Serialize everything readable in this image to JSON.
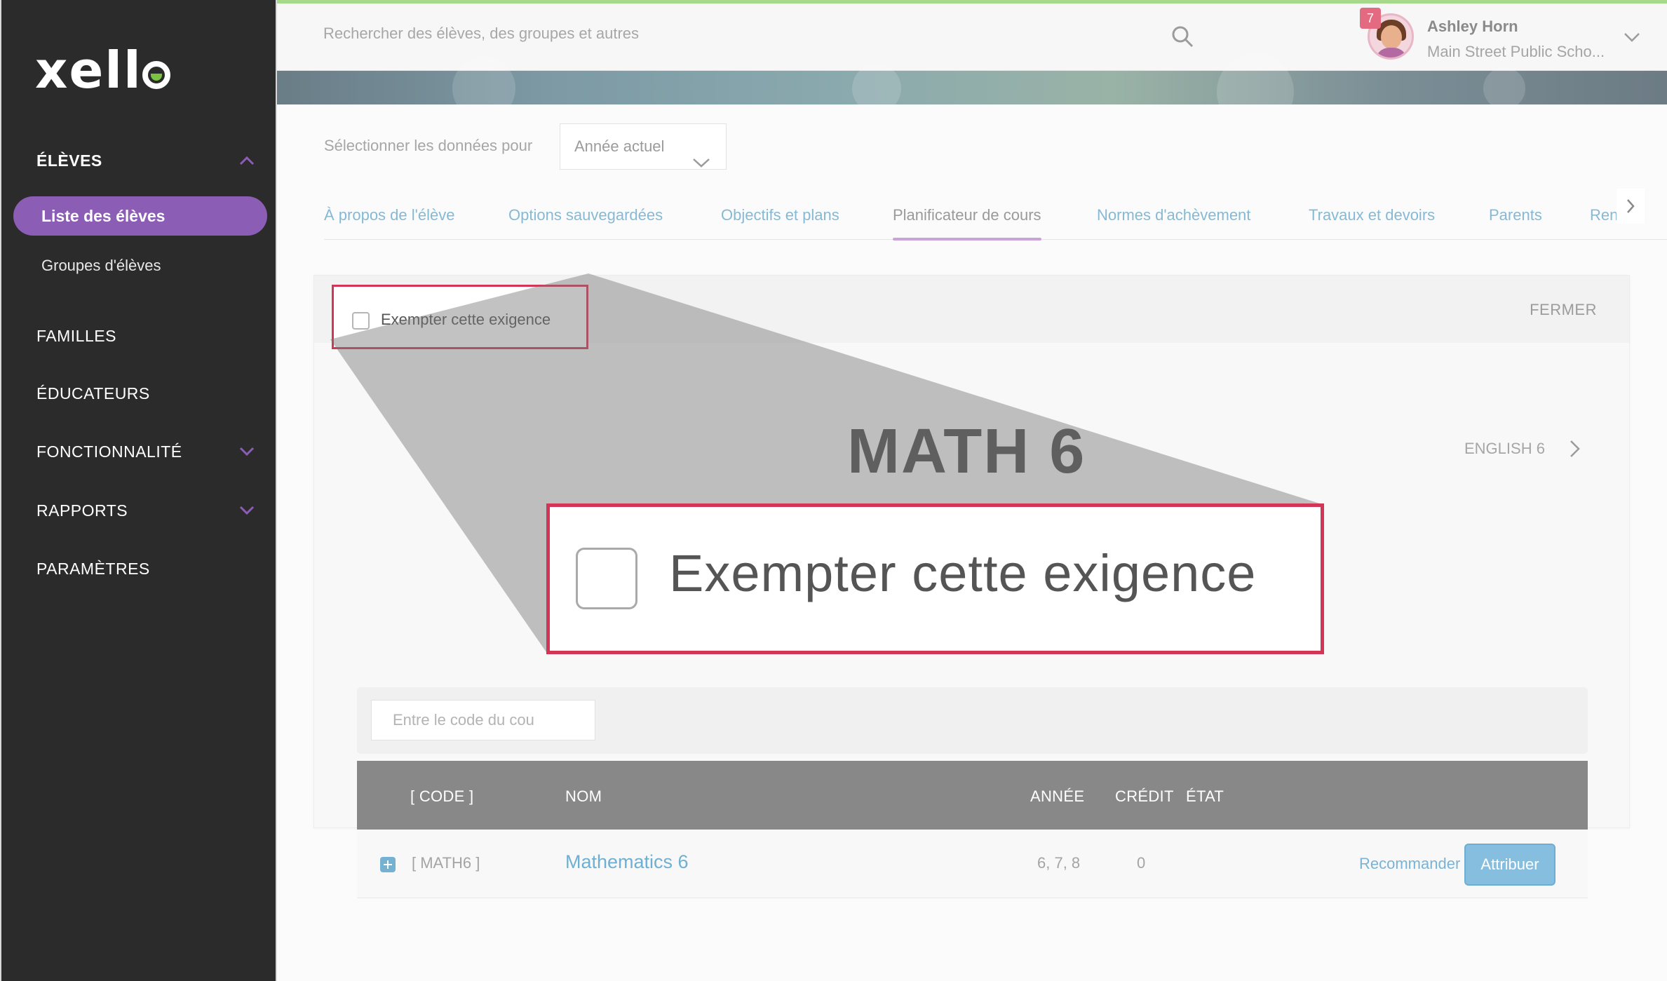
{
  "app": {
    "logo": "xello"
  },
  "sidebar": {
    "sections": [
      {
        "label": "ÉLÈVES",
        "expanded": true
      },
      {
        "label": "FAMILLES"
      },
      {
        "label": "ÉDUCATEURS"
      },
      {
        "label": "FONCTIONNALITÉ",
        "expanded": false
      },
      {
        "label": "RAPPORTS",
        "expanded": false
      },
      {
        "label": "PARAMÈTRES"
      }
    ],
    "items": [
      {
        "label": "Liste des élèves",
        "active": true
      },
      {
        "label": "Groupes d'élèves"
      }
    ],
    "accent_color": "#8b5db5"
  },
  "header": {
    "search_placeholder": "Rechercher des élèves, des groupes et autres",
    "notification_count": "7",
    "user_name": "Ashley Horn",
    "user_school": "Main Street Public Scho..."
  },
  "filter": {
    "label": "Sélectionner les données pour",
    "selected": "Année actuel"
  },
  "tabs": [
    {
      "label": "À propos de l'élève"
    },
    {
      "label": "Options sauvegardées"
    },
    {
      "label": "Objectifs et plans"
    },
    {
      "label": "Planificateur de cours",
      "active": true
    },
    {
      "label": "Normes d'achèvement"
    },
    {
      "label": "Travaux et devoirs"
    },
    {
      "label": "Parents"
    },
    {
      "label": "Ren"
    }
  ],
  "requirement_card": {
    "exempt_label": "Exempter cette exigence",
    "exempt_checked": false,
    "close_label": "FERMER",
    "course_title": "MATH 6",
    "next_course": "ENGLISH 6",
    "code_placeholder": "Entre le code du cou"
  },
  "table": {
    "headers": {
      "code": "[ CODE ]",
      "name": "NOM",
      "year": "ANNÉE",
      "credit": "CRÉDIT",
      "state": "ÉTAT"
    },
    "rows": [
      {
        "code": "[ MATH6 ]",
        "name": "Mathematics 6",
        "year": "6, 7, 8",
        "credit": "0",
        "state": "",
        "recommend": "Recommander",
        "assign": "Attribuer"
      }
    ]
  },
  "zoom_callout": {
    "label": "Exempter cette exigence",
    "highlight_color": "#d23555"
  }
}
